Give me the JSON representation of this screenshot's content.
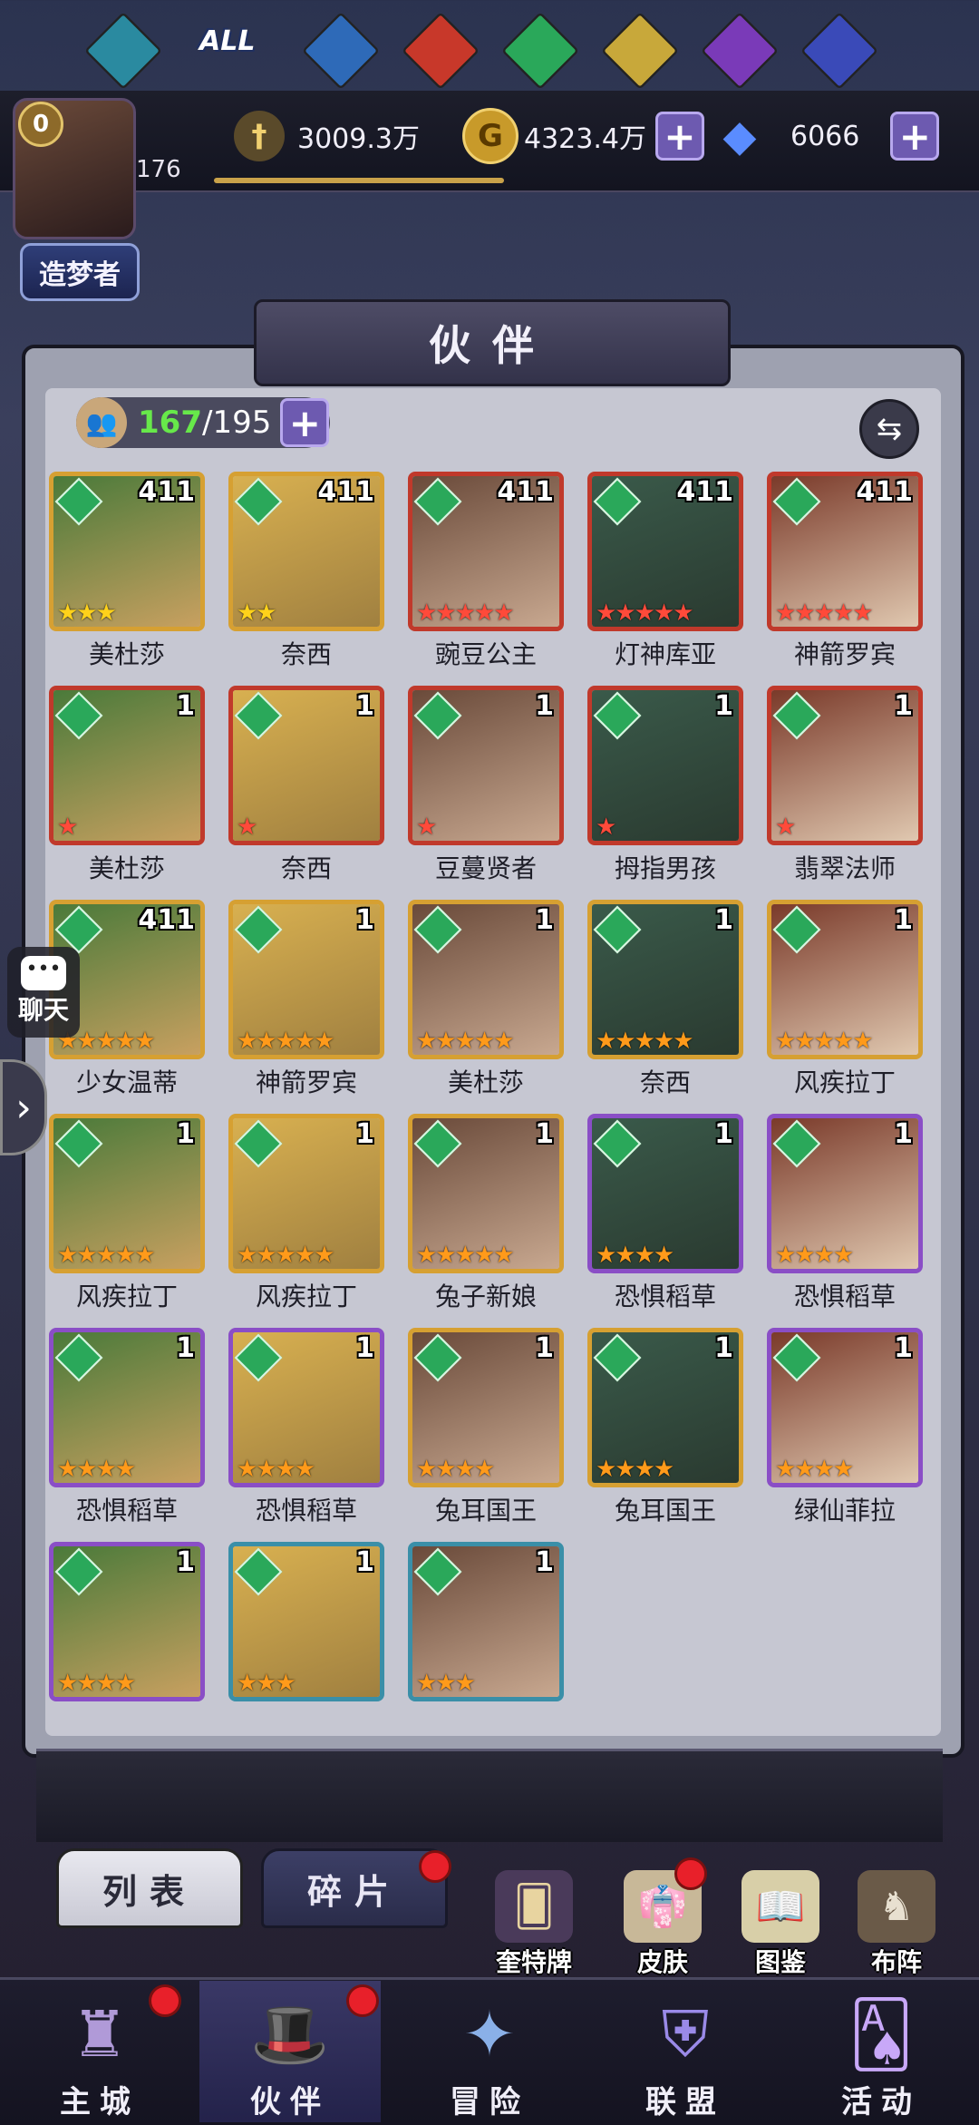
{
  "player": {
    "vip_level": "0",
    "level": "176",
    "title": "造梦者"
  },
  "resources": {
    "power": "3009.3万",
    "gold": "4323.4万",
    "diamonds": "6066"
  },
  "page_title": "伙伴",
  "capacity": {
    "current": "167",
    "separator": "/",
    "max": "195"
  },
  "heroes": [
    {
      "name": "美杜莎",
      "level": "411",
      "stars": "★★★",
      "star_color": "yellow"
    },
    {
      "name": "奈西",
      "level": "411",
      "stars": "★★",
      "star_color": "yellow"
    },
    {
      "name": "豌豆公主",
      "level": "411",
      "stars": "★★★★★",
      "star_color": "red"
    },
    {
      "name": "灯神库亚",
      "level": "411",
      "stars": "★★★★★",
      "star_color": "red"
    },
    {
      "name": "神箭罗宾",
      "level": "411",
      "stars": "★★★★★",
      "star_color": "red"
    },
    {
      "name": "美杜莎",
      "level": "1",
      "stars": "★",
      "star_color": "red"
    },
    {
      "name": "奈西",
      "level": "1",
      "stars": "★",
      "star_color": "red"
    },
    {
      "name": "豆蔓贤者",
      "level": "1",
      "stars": "★",
      "star_color": "red"
    },
    {
      "name": "拇指男孩",
      "level": "1",
      "stars": "★",
      "star_color": "red"
    },
    {
      "name": "翡翠法师",
      "level": "1",
      "stars": "★",
      "star_color": "red"
    },
    {
      "name": "少女温蒂",
      "level": "411",
      "stars": "★★★★★",
      "star_color": "orange"
    },
    {
      "name": "神箭罗宾",
      "level": "1",
      "stars": "★★★★★",
      "star_color": "orange"
    },
    {
      "name": "美杜莎",
      "level": "1",
      "stars": "★★★★★",
      "star_color": "orange"
    },
    {
      "name": "奈西",
      "level": "1",
      "stars": "★★★★★",
      "star_color": "orange"
    },
    {
      "name": "风疾拉丁",
      "level": "1",
      "stars": "★★★★★",
      "star_color": "orange"
    },
    {
      "name": "风疾拉丁",
      "level": "1",
      "stars": "★★★★★",
      "star_color": "orange"
    },
    {
      "name": "风疾拉丁",
      "level": "1",
      "stars": "★★★★★",
      "star_color": "orange"
    },
    {
      "name": "兔子新娘",
      "level": "1",
      "stars": "★★★★★",
      "star_color": "orange"
    },
    {
      "name": "恐惧稻草",
      "level": "1",
      "stars": "★★★★",
      "star_color": "orange"
    },
    {
      "name": "恐惧稻草",
      "level": "1",
      "stars": "★★★★",
      "star_color": "orange"
    },
    {
      "name": "恐惧稻草",
      "level": "1",
      "stars": "★★★★",
      "star_color": "orange"
    },
    {
      "name": "恐惧稻草",
      "level": "1",
      "stars": "★★★★",
      "star_color": "orange"
    },
    {
      "name": "兔耳国王",
      "level": "1",
      "stars": "★★★★",
      "star_color": "orange"
    },
    {
      "name": "兔耳国王",
      "level": "1",
      "stars": "★★★★",
      "star_color": "orange"
    },
    {
      "name": "绿仙菲拉",
      "level": "1",
      "stars": "★★★★",
      "star_color": "orange"
    },
    {
      "name": "",
      "level": "1",
      "stars": "★★★★",
      "star_color": "orange"
    },
    {
      "name": "",
      "level": "1",
      "stars": "★★★",
      "star_color": "orange"
    },
    {
      "name": "",
      "level": "1",
      "stars": "★★★",
      "star_color": "orange"
    }
  ],
  "filters": {
    "all_label": "ALL"
  },
  "subtabs": {
    "list": "列表",
    "fragments": "碎片"
  },
  "shortcuts": {
    "tarot": "奎特牌",
    "skins": "皮肤",
    "codex": "图鉴",
    "formation": "布阵"
  },
  "nav": {
    "city": "主城",
    "partners": "伙伴",
    "adventure": "冒险",
    "alliance": "联盟",
    "events": "活动"
  },
  "chat": {
    "label": "聊天"
  },
  "colors": {
    "accent": "#6d5ab0",
    "green_count": "#67e84a",
    "notify": "#e8202a"
  }
}
